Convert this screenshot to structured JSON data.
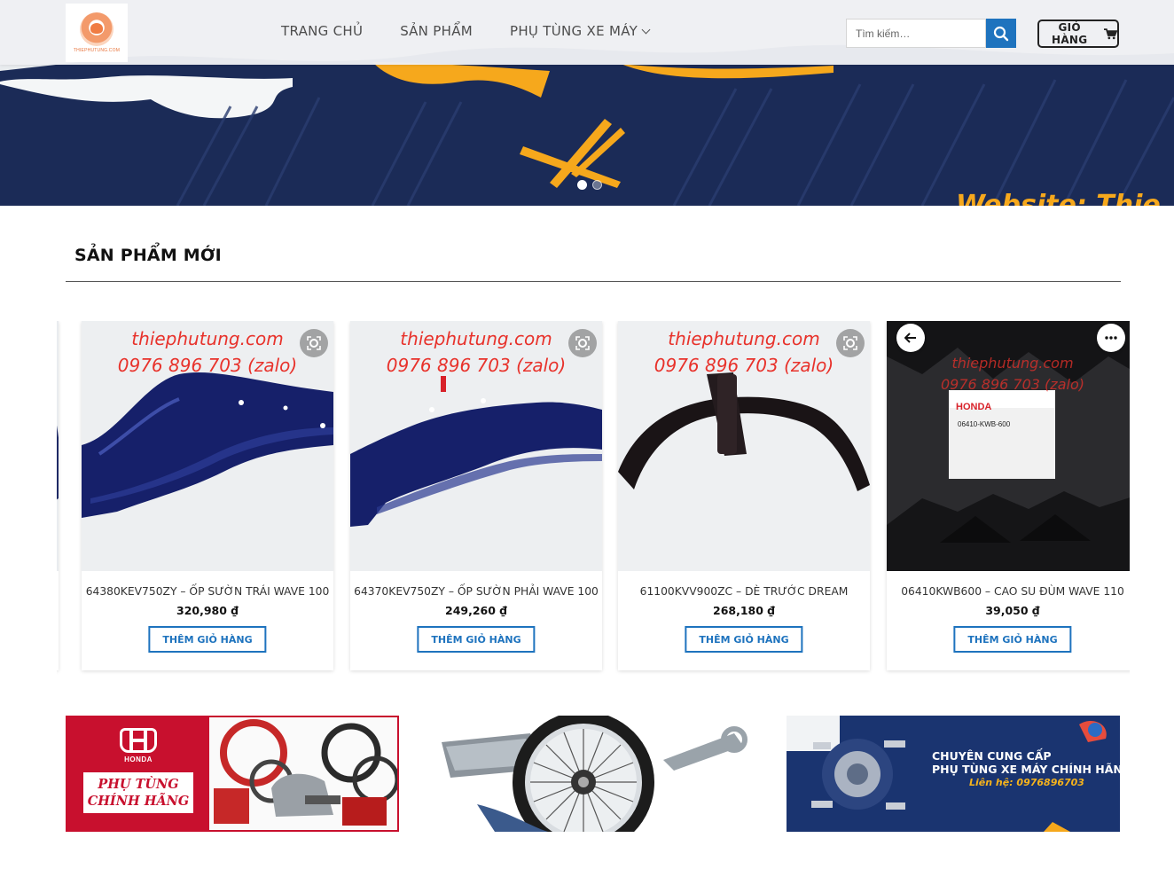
{
  "header": {
    "logo_text": "THIEPHUTUNG.COM",
    "nav": [
      {
        "label": "TRANG CHỦ"
      },
      {
        "label": "SẢN PHẨM"
      },
      {
        "label": "PHỤ TÙNG XE MÁY",
        "has_dropdown": true
      }
    ],
    "search": {
      "placeholder": "Tìm kiếm…",
      "icon": "search-icon"
    },
    "cart": {
      "label": "GIỎ HÀNG",
      "icon": "cart-icon"
    }
  },
  "hero": {
    "text": "Website: Thie",
    "slides": 2,
    "active_slide": 1
  },
  "section": {
    "title": "SẢN PHẨM MỚI"
  },
  "watermark": {
    "site": "thiephutung.com",
    "phone": "0976 896 703 (zalo)"
  },
  "products": [
    {
      "name": "64380KEV750ZY – ỐP SƯỜN TRÁI WAVE 100",
      "price": "320,980 ₫",
      "button": "THÊM GIỎ HÀNG"
    },
    {
      "name": "64370KEV750ZY – ỐP SƯỜN PHẢI WAVE 100",
      "price": "249,260 ₫",
      "button": "THÊM GIỎ HÀNG"
    },
    {
      "name": "61100KVV900ZC – DÈ TRƯỚC DREAM",
      "price": "268,180 ₫",
      "button": "THÊM GIỎ HÀNG"
    },
    {
      "name": "06410KWB600 – CAO SU ĐÙM WAVE 110",
      "price": "39,050 ₫",
      "button": "THÊM GIỎ HÀNG",
      "package_text": {
        "brand": "HONDA",
        "code": "06410-KWB-600"
      }
    }
  ],
  "banners": {
    "honda": {
      "brand": "HONDA",
      "line1": "PHỤ TÙNG",
      "line2": "CHÍNH HÃNG"
    },
    "supplier": {
      "line1": "CHUYÊN CUNG CẤP",
      "line2": "PHỤ TÙNG XE MÁY CHÍNH HÃNG",
      "contact": "Liên hệ: 0976896703"
    }
  },
  "colors": {
    "primary": "#1e73be",
    "hero_blue": "#1b2b57",
    "accent_orange": "#f6a81c",
    "honda_red": "#c8102e",
    "watermark_red": "#e8322b"
  }
}
